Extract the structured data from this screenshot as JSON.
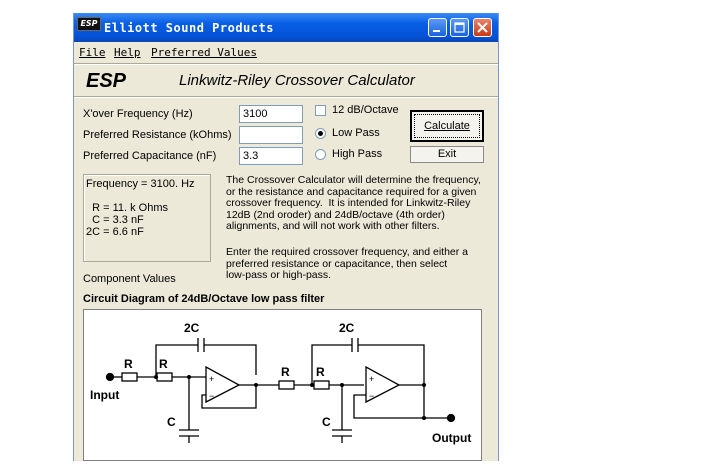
{
  "window": {
    "icon_text": "ESP",
    "title": "Elliott Sound Products"
  },
  "menu": [
    "File",
    "Help",
    "Preferred Values"
  ],
  "header": {
    "logo": "ESP",
    "title": "Linkwitz-Riley Crossover Calculator"
  },
  "form": {
    "frequency_label": "X'over Frequency (Hz)",
    "frequency_value": "3100",
    "resistance_label": "Preferred Resistance (kOhms)",
    "resistance_value": "",
    "capacitance_label": "Preferred Capacitance (nF)",
    "capacitance_value": "3.3",
    "slope_12_label": "12 dB/Octave",
    "slope_12_checked": false,
    "low_pass_label": "Low Pass",
    "high_pass_label": "High Pass",
    "selected_filter": "Low Pass",
    "calculate_label": "Calculate",
    "exit_label": "Exit"
  },
  "results": {
    "text": "Frequency = 3100. Hz\n\n  R = 11. k Ohms\n  C = 3.3 nF\n2C = 6.6 nF",
    "caption": "Component Values"
  },
  "description": {
    "para1": "The Crossover Calculator will determine the frequency,\nor the resistance and capacitance required for a given\ncrossover frequency.  It is intended for Linkwitz-Riley\n12dB (2nd oroder) and 24dB/octave (4th order)\nalignments, and will not work with other filters.",
    "para2": "Enter the required crossover frequency, and either a\npreferred resistance or capacitance, then select\nlow-pass or high-pass."
  },
  "diagram": {
    "title": "Circuit Diagram of 24dB/Octave low pass filter",
    "labels": {
      "cap_2c": "2C",
      "resistor": "R",
      "cap_c": "C",
      "plus": "+",
      "minus": "−",
      "input": "Input",
      "output": "Output"
    }
  }
}
